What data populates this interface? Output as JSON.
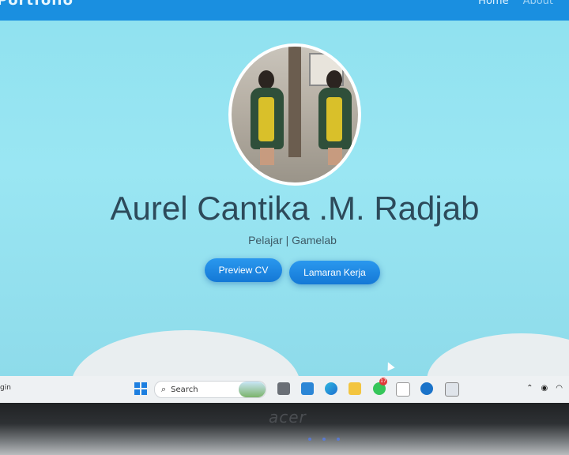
{
  "navbar": {
    "brand": "Portfolio",
    "links": [
      {
        "label": "Home"
      },
      {
        "label": "About"
      }
    ]
  },
  "profile": {
    "name": "Aurel Cantika .M. Radjab",
    "subtitle": "Pelajar | Gamelab"
  },
  "buttons": {
    "preview_cv": "Preview CV",
    "lamaran_kerja": "Lamaran Kerja"
  },
  "taskbar": {
    "left_text": "gin",
    "search_label": "Search",
    "whatsapp_badge": "17"
  },
  "bezel": {
    "brand": "acer"
  },
  "colors": {
    "accent": "#1a8fe0",
    "background": "#9ae6f3",
    "button": "#1e88e5",
    "name_text": "#2d4a5a"
  }
}
